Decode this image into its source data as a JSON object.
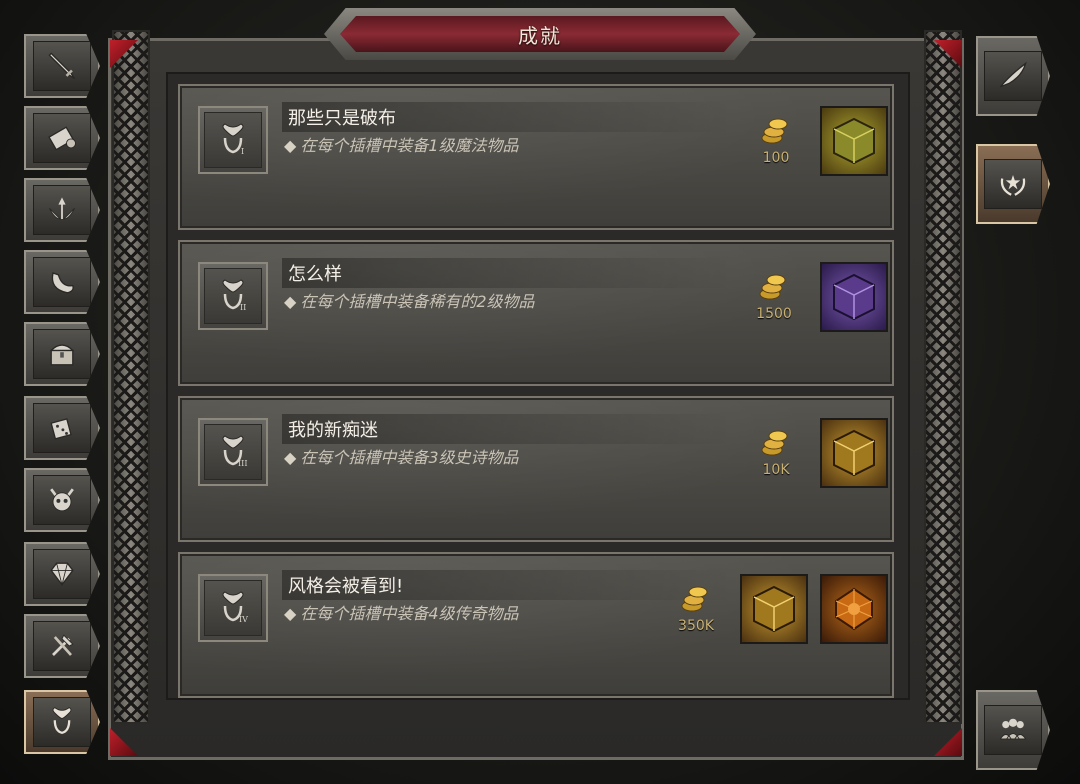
{
  "title": "成就",
  "left_menu": [
    {
      "icon": "sword-icon"
    },
    {
      "icon": "scroll-icon"
    },
    {
      "icon": "winged-arrow-icon"
    },
    {
      "icon": "horn-icon"
    },
    {
      "icon": "treasure-chest-icon"
    },
    {
      "icon": "dice-icon"
    },
    {
      "icon": "demon-skull-icon"
    },
    {
      "icon": "gem-icon"
    },
    {
      "icon": "hammer-pick-icon"
    },
    {
      "icon": "achievement-trophy-icon",
      "active": true
    }
  ],
  "right_menu": [
    {
      "icon": "quill-icon"
    },
    {
      "icon": "laurel-star-icon",
      "active": true
    },
    {
      "icon": "group-icon"
    }
  ],
  "achievements": [
    {
      "name": "那些只是破布",
      "description": "在每个插槽中装备1级魔法物品",
      "badge_numeral": "I",
      "gold": "100",
      "rewards": [
        {
          "icon": "gold-cube-icon",
          "color": "#8a8a2a"
        }
      ]
    },
    {
      "name": "怎么样",
      "description": "在每个插槽中装备稀有的2级物品",
      "badge_numeral": "II",
      "gold": "1500",
      "rewards": [
        {
          "icon": "purple-cube-icon",
          "color": "#5a3a8a"
        }
      ]
    },
    {
      "name": "我的新痴迷",
      "description": "在每个插槽中装备3级史诗物品",
      "badge_numeral": "III",
      "gold": "10K",
      "rewards": [
        {
          "icon": "amber-cube-icon",
          "color": "#a0781e"
        }
      ]
    },
    {
      "name": "风格会被看到!",
      "description": "在每个插槽中装备4级传奇物品",
      "badge_numeral": "IV",
      "gold": "350K",
      "rewards": [
        {
          "icon": "amber-cube-icon",
          "color": "#a0781e"
        },
        {
          "icon": "orange-gem-icon",
          "color": "#c86a14"
        }
      ]
    }
  ],
  "colors": {
    "accent_red": "#8a2a34",
    "gold_text": "#c8b070"
  }
}
